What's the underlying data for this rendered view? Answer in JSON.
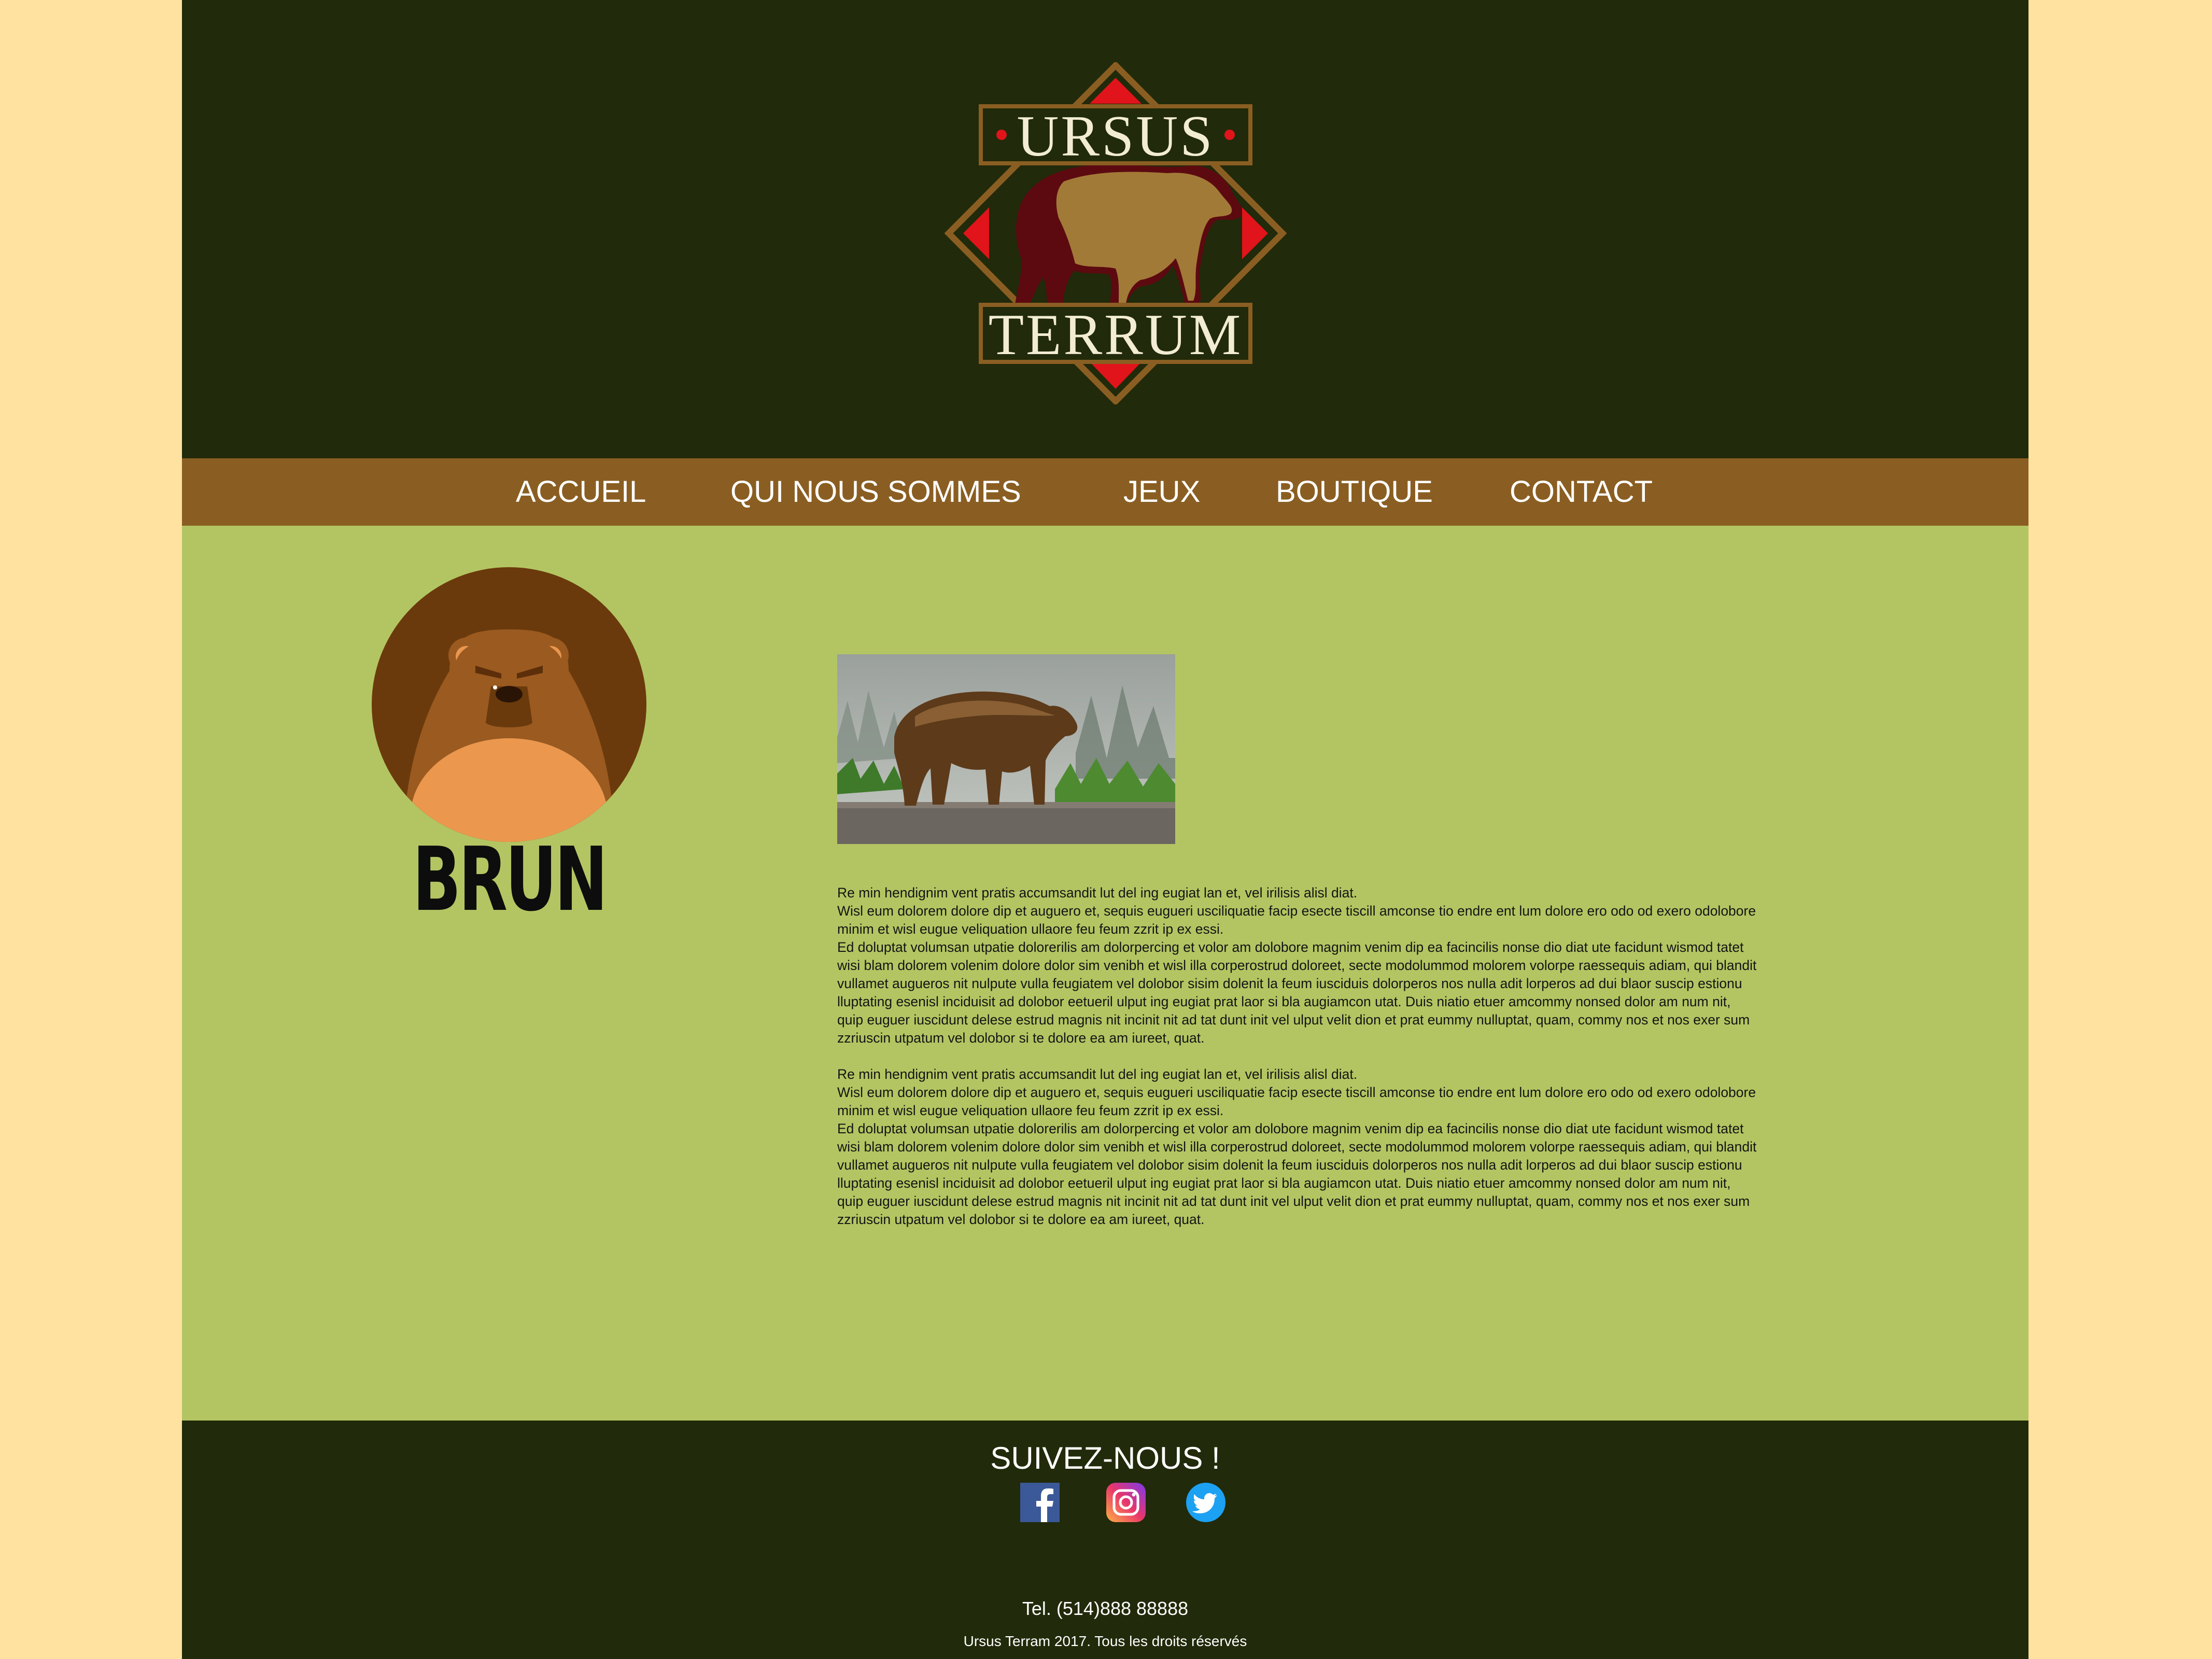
{
  "colors": {
    "outer_background": "#ffe1a0",
    "header_background": "#212a0a",
    "nav_background": "#8a5e22",
    "content_background": "#b3c562",
    "footer_background": "#212a0a",
    "logo_red": "#e0141a",
    "logo_brown": "#8a5e22",
    "avatar_dark_brown": "#6b3a0c"
  },
  "header": {
    "logo": {
      "top_word": "URSUS",
      "bottom_word": "TERRUM"
    }
  },
  "nav": {
    "items": [
      {
        "label": "ACCUEIL"
      },
      {
        "label": "QUI NOUS SOMMES"
      },
      {
        "label": "JEUX"
      },
      {
        "label": "BOUTIQUE"
      },
      {
        "label": "CONTACT"
      }
    ]
  },
  "main": {
    "bear_name": "BRUN",
    "avatar_icon": "brown-bear-face-icon",
    "photo_subject": "brown-bear-photo",
    "paragraphs": [
      {
        "lines": [
          "Re min hendignim vent pratis accumsandit lut del ing eugiat lan et, vel irilisis alisl diat.",
          "Wisl eum dolorem dolore dip et auguero et, sequis eugueri usciliquatie facip esecte tiscill amconse tio endre ent lum dolore ero odo od exero odolobore",
          "minim et wisl eugue veliquation ullaore feu feum zzrit ip ex essi.",
          "Ed doluptat volumsan utpatie dolorerilis am dolorpercing et volor am dolobore magnim venim dip ea facincilis nonse dio diat ute facidunt wismod tatet",
          "wisi blam dolorem volenim dolore dolor sim venibh et wisl illa corperostrud doloreet, secte modolummod molorem volorpe raessequis adiam, qui blandit",
          "vullamet augueros nit nulpute vulla feugiatem vel dolobor sisim dolenit la feum iusciduis dolorperos nos nulla adit lorperos ad dui blaor suscip estionu",
          "lluptating esenisl inciduisit ad dolobor eetueril ulput ing eugiat prat laor si bla augiamcon utat. Duis niatio etuer amcommy nonsed dolor am num nit,",
          "quip euguer iuscidunt delese estrud magnis nit incinit nit ad tat dunt init vel ulput velit dion et prat eummy nulluptat, quam, commy nos et nos exer sum",
          "zzriuscin utpatum vel dolobor si te dolore ea am iureet, quat."
        ]
      },
      {
        "lines": [
          "Re min hendignim vent pratis accumsandit lut del ing eugiat lan et, vel irilisis alisl diat.",
          "Wisl eum dolorem dolore dip et auguero et, sequis eugueri usciliquatie facip esecte tiscill amconse tio endre ent lum dolore ero odo od exero odolobore",
          "minim et wisl eugue veliquation ullaore feu feum zzrit ip ex essi.",
          "Ed doluptat volumsan utpatie dolorerilis am dolorpercing et volor am dolobore magnim venim dip ea facincilis nonse dio diat ute facidunt wismod tatet",
          "wisi blam dolorem volenim dolore dolor sim venibh et wisl illa corperostrud doloreet, secte modolummod molorem volorpe raessequis adiam, qui blandit",
          "vullamet augueros nit nulpute vulla feugiatem vel dolobor sisim dolenit la feum iusciduis dolorperos nos nulla adit lorperos ad dui blaor suscip estionu",
          "lluptating esenisl inciduisit ad dolobor eetueril ulput ing eugiat prat laor si bla augiamcon utat. Duis niatio etuer amcommy nonsed dolor am num nit,",
          "quip euguer iuscidunt delese estrud magnis nit incinit nit ad tat dunt init vel ulput velit dion et prat eummy nulluptat, quam, commy nos et nos exer sum",
          "zzriuscin utpatum vel dolobor si te dolore ea am iureet, quat."
        ]
      }
    ]
  },
  "footer": {
    "follow_label": "SUIVEZ-NOUS !",
    "social": [
      {
        "icon": "facebook-icon",
        "color": "#3b5998"
      },
      {
        "icon": "instagram-icon",
        "color": "#d6249f"
      },
      {
        "icon": "twitter-icon",
        "color": "#1da1f2"
      }
    ],
    "phone": "Tel. (514)888 88888",
    "copyright": "Ursus Terram 2017. Tous les droits réservés"
  }
}
